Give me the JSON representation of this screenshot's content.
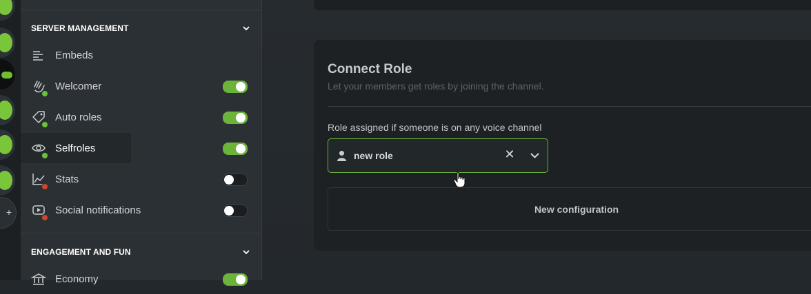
{
  "sidebar": {
    "sections": [
      {
        "title": "SERVER MANAGEMENT"
      },
      {
        "title": "ENGAGEMENT AND FUN"
      }
    ],
    "items": [
      {
        "label": "Embeds",
        "toggle": null
      },
      {
        "label": "Welcomer",
        "toggle": true,
        "status": "on"
      },
      {
        "label": "Auto roles",
        "toggle": true,
        "status": "on"
      },
      {
        "label": "Selfroles",
        "toggle": true,
        "status": "on",
        "active": true
      },
      {
        "label": "Stats",
        "toggle": false,
        "status": "off"
      },
      {
        "label": "Social notifications",
        "toggle": false,
        "status": "off"
      },
      {
        "label": "Economy",
        "toggle": true
      }
    ]
  },
  "card": {
    "title": "Connect Role",
    "subtitle": "Let your members get roles by joining the channel.",
    "field_label": "Role assigned if someone is on any voice channel",
    "select_value": "new role",
    "clear_glyph": "✕",
    "new_config_label": "New configuration"
  },
  "rail": {
    "add_glyph": "+"
  },
  "colors": {
    "accent": "#6cb33a",
    "status_on": "#6cc13a",
    "status_off": "#d0452f"
  }
}
